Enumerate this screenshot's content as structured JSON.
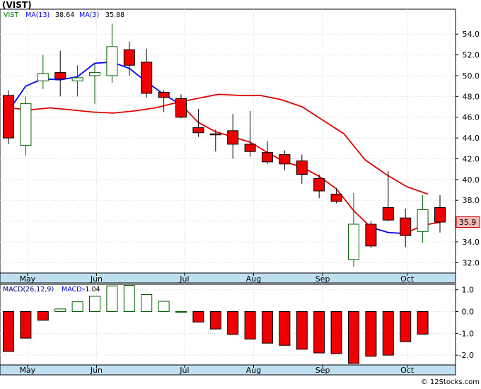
{
  "chart_data": [
    {
      "type": "candlestick",
      "title": "(VIST)",
      "legend": [
        {
          "label": "VIST",
          "value": "",
          "color": "#008000"
        },
        {
          "label": "MA(13)",
          "value": "38.64",
          "color": "#0000ff"
        },
        {
          "label": "MA(3)",
          "value": "35.88",
          "color": "#0000ff"
        }
      ],
      "last_price_label": "35.9",
      "x_tick_labels": [
        "May",
        "Jun",
        "Jul",
        "Aug",
        "Sep",
        "Oct"
      ],
      "ylim": [
        31.0,
        56.4
      ],
      "y_ticks": [
        32.0,
        34.0,
        36.0,
        38.0,
        40.0,
        42.0,
        44.0,
        46.0,
        48.0,
        50.0,
        52.0,
        54.0
      ],
      "y_tick_labels": [
        "32.0",
        "34.0",
        "36.0",
        "38.0",
        "40.0",
        "42.0",
        "44.0",
        "46.0",
        "48.0",
        "50.0",
        "52.0",
        "54.0"
      ],
      "candles": [
        {
          "open": 48.1,
          "high": 48.6,
          "low": 43.4,
          "close": 44.0
        },
        {
          "open": 43.3,
          "high": 48.0,
          "low": 42.3,
          "close": 47.3
        },
        {
          "open": 49.5,
          "high": 52.0,
          "low": 48.7,
          "close": 50.2
        },
        {
          "open": 50.3,
          "high": 52.4,
          "low": 48.0,
          "close": 49.7
        },
        {
          "open": 49.5,
          "high": 51.0,
          "low": 48.0,
          "close": 49.8
        },
        {
          "open": 50.0,
          "high": 51.2,
          "low": 47.3,
          "close": 50.3
        },
        {
          "open": 50.0,
          "high": 55.0,
          "low": 49.3,
          "close": 52.8
        },
        {
          "open": 52.5,
          "high": 53.3,
          "low": 50.0,
          "close": 51.0
        },
        {
          "open": 51.3,
          "high": 52.6,
          "low": 47.9,
          "close": 48.3
        },
        {
          "open": 48.4,
          "high": 48.6,
          "low": 46.5,
          "close": 47.9
        },
        {
          "open": 47.8,
          "high": 48.2,
          "low": 45.9,
          "close": 46.0
        },
        {
          "open": 45.0,
          "high": 46.8,
          "low": 44.1,
          "close": 44.5
        },
        {
          "open": 44.4,
          "high": 44.8,
          "low": 42.7,
          "close": 44.3
        },
        {
          "open": 44.7,
          "high": 46.3,
          "low": 42.0,
          "close": 43.4
        },
        {
          "open": 43.4,
          "high": 46.6,
          "low": 42.2,
          "close": 42.7
        },
        {
          "open": 42.6,
          "high": 43.7,
          "low": 41.5,
          "close": 41.7
        },
        {
          "open": 42.4,
          "high": 42.8,
          "low": 40.9,
          "close": 41.5
        },
        {
          "open": 41.8,
          "high": 42.4,
          "low": 39.6,
          "close": 40.5
        },
        {
          "open": 40.1,
          "high": 40.5,
          "low": 38.2,
          "close": 38.9
        },
        {
          "open": 38.6,
          "high": 39.2,
          "low": 37.7,
          "close": 37.9
        },
        {
          "open": 32.3,
          "high": 38.7,
          "low": 31.6,
          "close": 35.7
        },
        {
          "open": 35.7,
          "high": 36.0,
          "low": 33.4,
          "close": 33.6
        },
        {
          "open": 37.3,
          "high": 40.8,
          "low": 36.0,
          "close": 36.1
        },
        {
          "open": 36.3,
          "high": 37.2,
          "low": 33.5,
          "close": 34.6
        },
        {
          "open": 35.0,
          "high": 38.5,
          "low": 33.9,
          "close": 37.1
        },
        {
          "open": 37.3,
          "high": 38.5,
          "low": 34.9,
          "close": 35.9
        }
      ],
      "ma13": [
        46.9,
        46.7,
        46.9,
        46.7,
        46.5,
        46.4,
        46.6,
        46.9,
        47.4,
        47.8,
        48.2,
        48.1,
        48.1,
        47.7,
        47.0,
        45.7,
        44.4,
        41.9,
        40.5,
        39.3,
        38.6
      ],
      "ma3": [
        46.6,
        49.0,
        49.7,
        49.6,
        49.9,
        51.2,
        51.3,
        50.7,
        49.4,
        48.2,
        47.2,
        45.5,
        44.6,
        44.1,
        43.6,
        42.6,
        41.7,
        41.2,
        40.3,
        39.1,
        37.0,
        35.4,
        34.9,
        34.8,
        35.6,
        35.88
      ],
      "ma3_first_index": 0,
      "ma13_first_index": 0
    },
    {
      "type": "bar",
      "title": "MACD(26,12,9)",
      "legend": [
        {
          "label": "MACD(26,12,9)",
          "value": "",
          "color": "#000080"
        },
        {
          "label": "MACD:",
          "value": "-1.04",
          "color": "#0000ff"
        }
      ],
      "x_tick_labels": [
        "May",
        "Jun",
        "Jul",
        "Aug",
        "Sep",
        "Oct"
      ],
      "ylim": [
        -2.45,
        1.25
      ],
      "y_ticks": [
        1.0,
        0.0,
        -1.0,
        -2.0
      ],
      "y_tick_labels": [
        "1.0",
        "0.0",
        "-1.0",
        "-2.0"
      ],
      "values": [
        -1.83,
        -1.22,
        -0.4,
        0.12,
        0.45,
        0.7,
        1.18,
        1.2,
        0.78,
        0.47,
        0.0,
        -0.48,
        -0.8,
        -1.05,
        -1.26,
        -1.45,
        -1.55,
        -1.73,
        -1.9,
        -1.93,
        -2.38,
        -2.05,
        -2.0,
        -1.38,
        -1.04
      ]
    }
  ]
}
